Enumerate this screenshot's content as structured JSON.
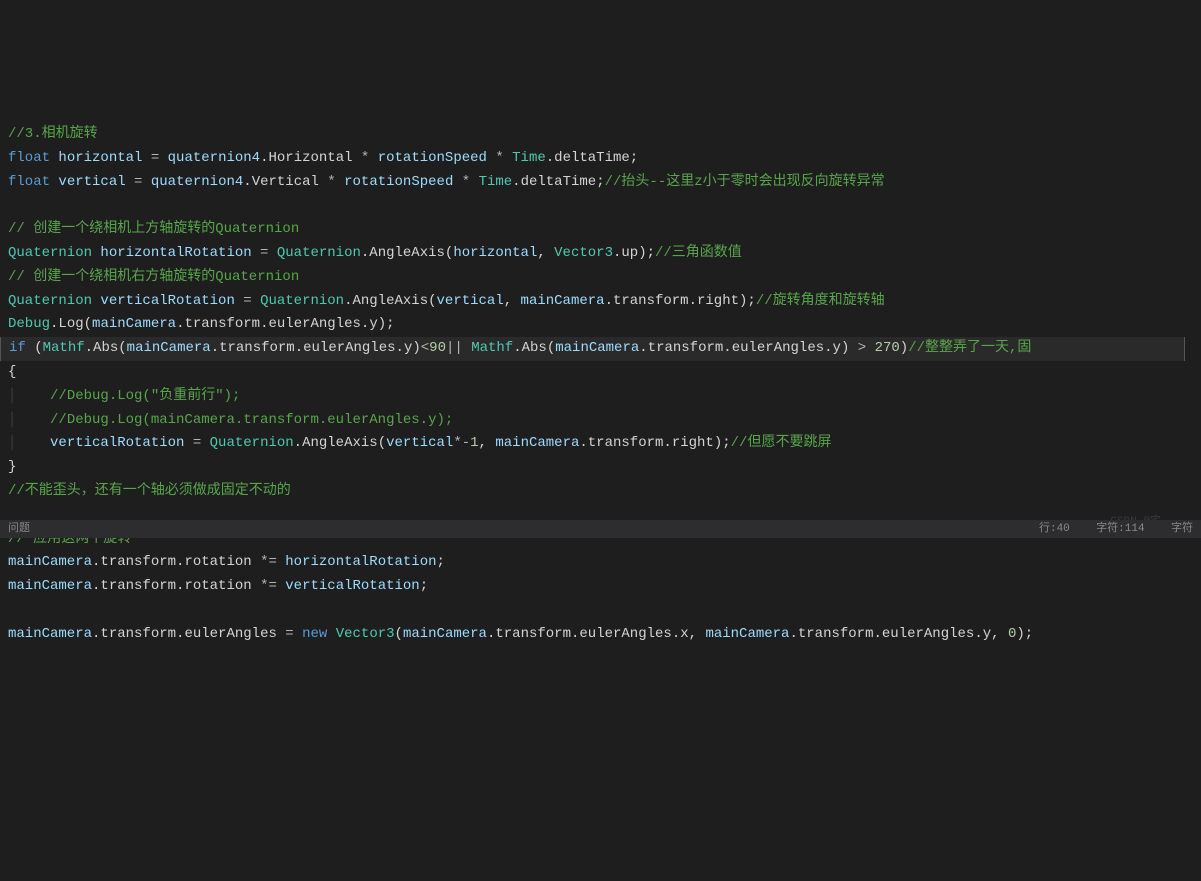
{
  "code": {
    "l1_comment": "//3.相机旋转",
    "l2": {
      "kw": "float",
      "var": "horizontal",
      "eq": " = ",
      "obj": "quaternion4",
      "dot1": ".",
      "mem1": "Horizontal",
      "op1": " * ",
      "var2": "rotationSpeed",
      "op2": " * ",
      "type2": "Time",
      "dot2": ".",
      "mem2": "deltaTime",
      "end": ";"
    },
    "l3": {
      "kw": "float",
      "var": "vertical",
      "eq": " = ",
      "obj": "quaternion4",
      "dot1": ".",
      "mem1": "Vertical",
      "op1": " * ",
      "var2": "rotationSpeed",
      "op2": " * ",
      "type2": "Time",
      "dot2": ".",
      "mem2": "deltaTime",
      "end": ";",
      "comment": "//抬头--这里z小于零时会出现反向旋转异常"
    },
    "l5_comment": "// 创建一个绕相机上方轴旋转的Quaternion",
    "l6": {
      "type1": "Quaternion",
      "var": "horizontalRotation",
      "eq": " = ",
      "type2": "Quaternion",
      "dot": ".",
      "method": "AngleAxis",
      "open": "(",
      "arg1": "horizontal",
      "comma": ", ",
      "type3": "Vector3",
      "dot2": ".",
      "mem": "up",
      "close": ")",
      "end": ";",
      "comment": "//三角函数值"
    },
    "l7_comment": "// 创建一个绕相机右方轴旋转的Quaternion",
    "l8": {
      "type1": "Quaternion",
      "var": "verticalRotation",
      "eq": " = ",
      "type2": "Quaternion",
      "dot": ".",
      "method": "AngleAxis",
      "open": "(",
      "arg1": "vertical",
      "comma": ", ",
      "obj": "mainCamera",
      "dot2": ".",
      "mem1": "transform",
      "dot3": ".",
      "mem2": "right",
      "close": ")",
      "end": ";",
      "comment": "//旋转角度和旋转轴"
    },
    "l9": {
      "type": "Debug",
      "dot": ".",
      "method": "Log",
      "open": "(",
      "obj": "mainCamera",
      "dot2": ".",
      "mem1": "transform",
      "dot3": ".",
      "mem2": "eulerAngles",
      "dot4": ".",
      "mem3": "y",
      "close": ")",
      "end": ";"
    },
    "l10": {
      "kw": "if",
      "open": " (",
      "type1": "Mathf",
      "dot1": ".",
      "method1": "Abs",
      "open2": "(",
      "obj1": "mainCamera",
      "dot2": ".",
      "mem1": "transform",
      "dot3": ".",
      "mem2": "eulerAngles",
      "dot4": ".",
      "mem3": "y",
      "close1": ")",
      "op1": "<",
      "num1": "90",
      "or": "||",
      "type2": " Mathf",
      "dot5": ".",
      "method2": "Abs",
      "open3": "(",
      "obj2": "mainCamera",
      "dot6": ".",
      "mem4": "transform",
      "dot7": ".",
      "mem5": "eulerAngles",
      "dot8": ".",
      "mem6": "y",
      "close2": ")",
      "op2": " > ",
      "num2": "270",
      "close3": ")",
      "comment": "//整整弄了一天,固"
    },
    "l11": "{",
    "l12_comment": "    //Debug.Log(\"负重前行\");",
    "l13_comment": "    //Debug.Log(mainCamera.transform.eulerAngles.y);",
    "l14": {
      "indent": "    ",
      "var": "verticalRotation",
      "eq": " = ",
      "type": "Quaternion",
      "dot": ".",
      "method": "AngleAxis",
      "open": "(",
      "arg1": "vertical",
      "op": "*-",
      "num": "1",
      "comma": ", ",
      "obj": "mainCamera",
      "dot2": ".",
      "mem1": "transform",
      "dot3": ".",
      "mem2": "right",
      "close": ")",
      "end": ";",
      "comment": "//但愿不要跳屏"
    },
    "l15": "}",
    "l16_comment": "//不能歪头，还有一个轴必须做成固定不动的",
    "l18_comment": "// 应用这两个旋转",
    "l19": {
      "obj": "mainCamera",
      "dot1": ".",
      "mem1": "transform",
      "dot2": ".",
      "mem2": "rotation",
      "op": " *= ",
      "var": "horizontalRotation",
      "end": ";"
    },
    "l20": {
      "obj": "mainCamera",
      "dot1": ".",
      "mem1": "transform",
      "dot2": ".",
      "mem2": "rotation",
      "op": " *= ",
      "var": "verticalRotation",
      "end": ";"
    },
    "l22": {
      "obj": "mainCamera",
      "dot1": ".",
      "mem1": "transform",
      "dot2": ".",
      "mem2": "eulerAngles",
      "eq": " = ",
      "kw": "new",
      "type": " Vector3",
      "open": "(",
      "obj2": "mainCamera",
      "dot3": ".",
      "mem3": "transform",
      "dot4": ".",
      "mem4": "eulerAngles",
      "dot5": ".",
      "mem5": "x",
      "comma": ", ",
      "obj3": "mainCamera",
      "dot6": ".",
      "mem6": "transform",
      "dot7": ".",
      "mem7": "eulerAngles",
      "dot8": ".",
      "mem8": "y",
      "comma2": ", ",
      "num": "0",
      "close": ")",
      "end": ";"
    }
  },
  "statusbar": {
    "left": "问题",
    "right": "行:40    字符:114    字符"
  },
  "watermark": "CSDN @宅"
}
